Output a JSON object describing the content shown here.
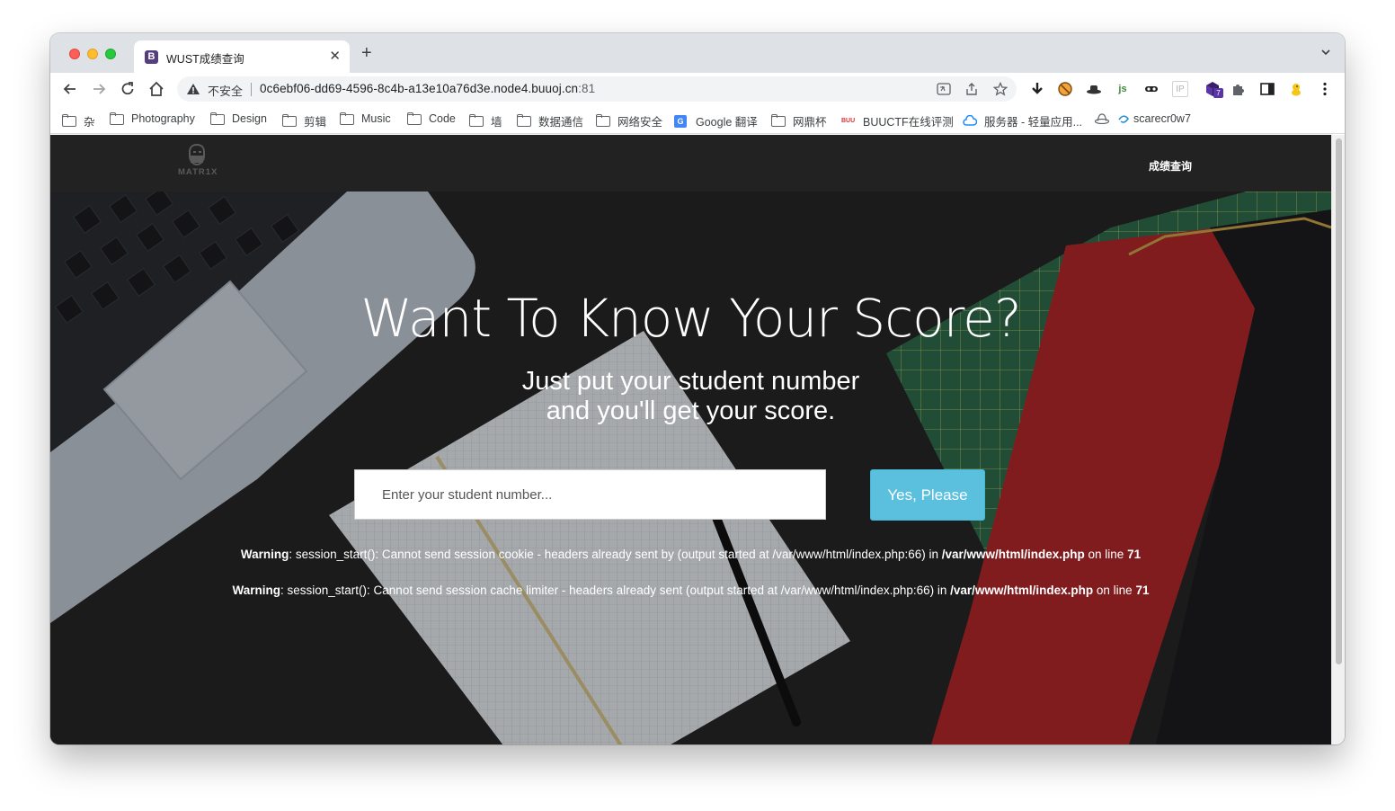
{
  "browser": {
    "tab_title": "WUST成绩查询",
    "tab_favicon_letter": "B",
    "close_glyph": "✕",
    "new_tab_glyph": "+",
    "security_label": "不安全",
    "url_host": "0c6ebf06-dd69-4596-8c4b-a13e10a76d3e.node4.buuoj.cn",
    "url_port": ":81",
    "bookmarks": [
      {
        "label": "杂",
        "icon": "folder-icon"
      },
      {
        "label": "Photography",
        "icon": "folder-icon"
      },
      {
        "label": "Design",
        "icon": "folder-icon"
      },
      {
        "label": "剪辑",
        "icon": "folder-icon"
      },
      {
        "label": "Music",
        "icon": "folder-icon"
      },
      {
        "label": "Code",
        "icon": "folder-icon"
      },
      {
        "label": "墙",
        "icon": "folder-icon"
      },
      {
        "label": "数据通信",
        "icon": "folder-icon"
      },
      {
        "label": "网络安全",
        "icon": "folder-icon"
      },
      {
        "label": "Google 翻译",
        "icon": "google-translate-icon"
      },
      {
        "label": "网鼎杯",
        "icon": "folder-icon"
      },
      {
        "label": "BUUCTF在线评测",
        "icon": "buuctf-icon"
      },
      {
        "label": "服务器 - 轻量应用...",
        "icon": "cloud-icon"
      },
      {
        "label": "",
        "icon": "hat-icon"
      },
      {
        "label": "scarecr0w7",
        "icon": "swirl-icon"
      }
    ],
    "extensions": [
      "download-icon",
      "blocked-extension-icon",
      "hat-extension-icon",
      "js-extension-icon",
      "mask-extension-icon",
      "ip-extension-icon",
      "badge-extension-icon",
      "puzzle-icon",
      "sidepanel-icon",
      "duck-extension-icon",
      "menu-dots-icon"
    ],
    "extension_badge": "7",
    "ip_label": "IP",
    "js_label": "js"
  },
  "site": {
    "logo_text": "MATR1X",
    "nav_link": "成绩查询",
    "hero_title": "Want To Know Your Score?",
    "hero_sub_line1": "Just put your student number",
    "hero_sub_line2": "and you'll get your score.",
    "input_placeholder": "Enter your student number...",
    "submit_label": "Yes, Please",
    "warnings": [
      {
        "label": "Warning",
        "message": ": session_start(): Cannot send session cookie - headers already sent by (output started at /var/www/html/index.php:66) in ",
        "file": "/var/www/html/index.php",
        "on_line": " on line ",
        "line": "71"
      },
      {
        "label": "Warning",
        "message": ": session_start(): Cannot send session cache limiter - headers already sent (output started at /var/www/html/index.php:66) in ",
        "file": "/var/www/html/index.php",
        "on_line": " on line ",
        "line": "71"
      }
    ]
  },
  "colors": {
    "button": "#5bc0de",
    "navbar": "#222222",
    "tabstrip": "#dee1e6"
  }
}
